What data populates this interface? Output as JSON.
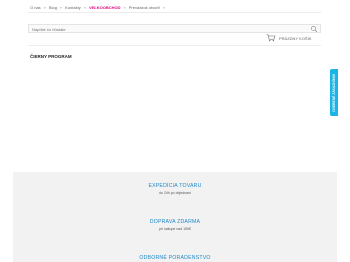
{
  "breadcrumb": {
    "items": [
      "O nás",
      "Blog",
      "Kontakty",
      "VEĽKOOBCHOD",
      "Prevádzok otvoriť"
    ]
  },
  "search": {
    "placeholder": "Napíšte čo hľadáte"
  },
  "cart": {
    "label": "PRÁZDNY KOŠÍK"
  },
  "main": {
    "section_title": "ČIERNY PROGRAM"
  },
  "side_tab": {
    "label": "OVERENÉ ZÁKAZNÍKMI"
  },
  "features": [
    {
      "title": "EXPEDÍCIA TOVARU",
      "subtitle": "do 24h po objednaní"
    },
    {
      "title": "DOPRAVA ZDARMA",
      "subtitle": "pri nákupe nad 150€"
    },
    {
      "title": "ODBORNÉ PORADENSTVO",
      "subtitle": ""
    }
  ],
  "colors": {
    "accent": "#e0007a",
    "link_blue": "#1e88c9",
    "side_tab": "#19b5e6",
    "footer_bg": "#f2f2f2"
  },
  "icons": {
    "search": "search-icon",
    "cart": "cart-icon"
  }
}
